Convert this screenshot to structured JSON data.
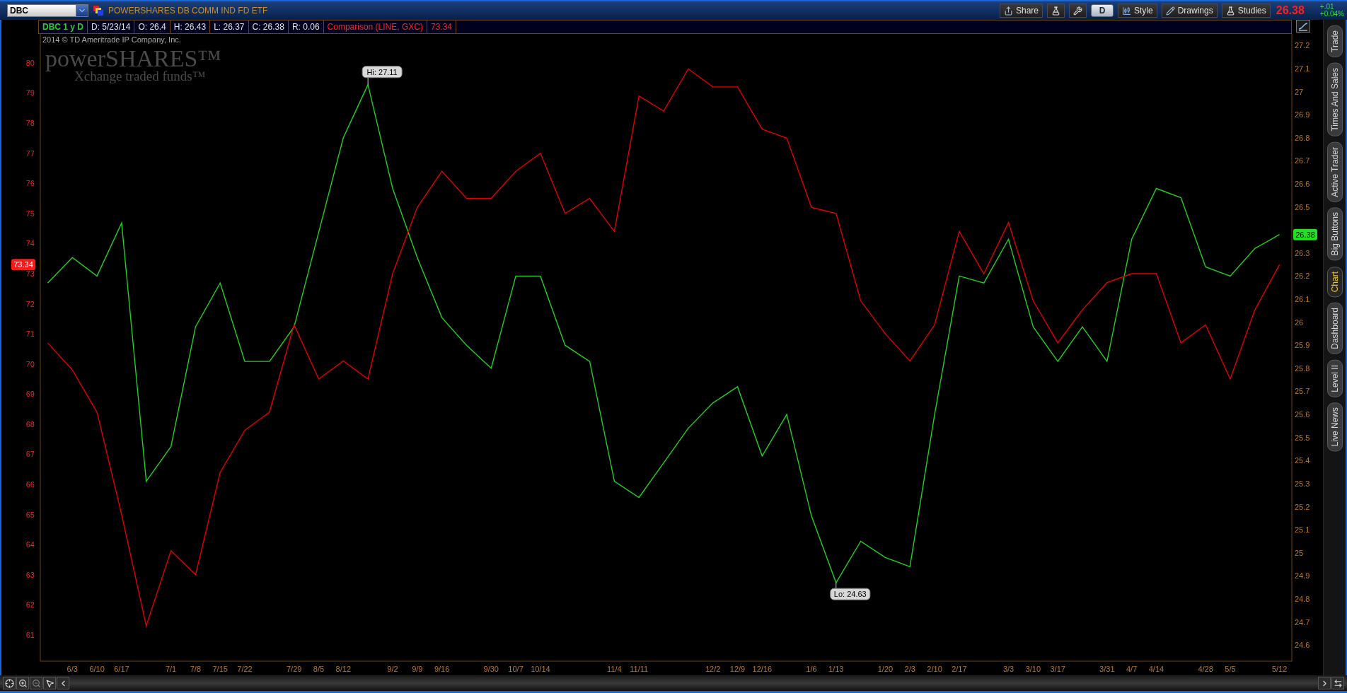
{
  "symbol_field": {
    "value": "DBC"
  },
  "security_title": "POWERSHARES DB COMM IND FD ETF",
  "toolbar": [
    {
      "kind": "share",
      "label": "Share"
    },
    {
      "kind": "studies_edit"
    },
    {
      "kind": "settings"
    },
    {
      "kind": "period",
      "label": "D"
    },
    {
      "kind": "style",
      "label": "Style"
    },
    {
      "kind": "drawings",
      "label": "Drawings"
    },
    {
      "kind": "studies",
      "label": "Studies"
    }
  ],
  "last_price": "26.38",
  "net_change": "+.01",
  "percent_change": "+0.04%",
  "info_bar": [
    {
      "kind": "symbol",
      "text": "DBC 1 y D"
    },
    {
      "kind": "stat",
      "text": "D: 5/23/14"
    },
    {
      "kind": "stat",
      "text": "O: 26.4"
    },
    {
      "kind": "stat",
      "text": "H: 26.43"
    },
    {
      "kind": "stat",
      "text": "L: 26.37"
    },
    {
      "kind": "stat",
      "text": "C: 26.38"
    },
    {
      "kind": "stat",
      "text": "R: 0.06"
    },
    {
      "kind": "comparison",
      "text": "Comparison (LINE, GXC)"
    },
    {
      "kind": "comparison",
      "text": "73.34"
    }
  ],
  "chart": {
    "copyright": "2014 © TD Ameritrade IP Company, Inc.",
    "logo": {
      "name": "powerSHARES™",
      "tagline": "Xchange traded funds™"
    },
    "left_badge": "73.34",
    "right_badge": "26.38",
    "chart_data": {
      "type": "line",
      "categories": [
        null,
        "6/3",
        "6/10",
        "6/17",
        null,
        "7/1",
        "7/8",
        "7/15",
        "7/22",
        null,
        "7/29",
        "8/5",
        "8/12",
        null,
        "9/2",
        "9/9",
        "9/16",
        null,
        "9/30",
        "10/7",
        "10/14",
        null,
        null,
        "11/4",
        "11/11",
        null,
        null,
        "12/2",
        "12/9",
        "12/16",
        null,
        "1/6",
        "1/13",
        null,
        "1/20",
        "2/3",
        "2/10",
        "2/17",
        null,
        "3/3",
        "3/10",
        "3/17",
        null,
        "3/31",
        "4/7",
        "4/14",
        null,
        "4/28",
        "5/5",
        null,
        "5/12"
      ],
      "series": [
        {
          "color": "#22d022",
          "values": [
            26.17,
            26.28,
            26.2,
            26.43,
            25.31,
            25.46,
            25.98,
            26.17,
            25.83,
            25.83,
            25.98,
            26.39,
            26.8,
            27.03,
            26.58,
            26.28,
            26.02,
            25.9,
            25.8,
            26.2,
            26.2,
            25.9,
            25.83,
            25.31,
            25.24,
            25.39,
            25.54,
            25.65,
            25.72,
            25.42,
            25.6,
            25.16,
            24.87,
            25.05,
            24.98,
            24.94,
            25.6,
            26.2,
            26.17,
            26.36,
            25.98,
            25.83,
            25.98,
            25.83,
            26.36,
            26.58,
            26.54,
            26.24,
            26.2,
            26.32,
            26.38
          ]
        },
        {
          "axis": "y2",
          "color": "#e00000",
          "values": [
            70.7,
            69.8,
            68.4,
            65.0,
            61.3,
            63.8,
            63.0,
            66.4,
            67.8,
            68.4,
            71.3,
            69.5,
            70.1,
            69.5,
            73.0,
            75.2,
            76.4,
            75.5,
            75.5,
            76.4,
            77.0,
            75.0,
            75.5,
            74.4,
            78.9,
            78.4,
            79.8,
            79.2,
            79.2,
            77.8,
            77.5,
            75.2,
            75.0,
            72.1,
            71.0,
            70.1,
            71.3,
            74.4,
            73.0,
            74.7,
            72.1,
            70.7,
            71.8,
            72.7,
            73.0,
            73.0,
            70.7,
            71.3,
            69.5,
            71.8,
            73.3
          ]
        }
      ],
      "ylim": [
        24.53,
        27.25
      ],
      "y2lim": [
        60.13,
        80.96
      ],
      "yticks": [
        24.6,
        24.7,
        24.8,
        24.9,
        25,
        25.1,
        25.2,
        25.3,
        25.4,
        25.5,
        25.6,
        25.7,
        25.8,
        25.9,
        26,
        26.1,
        26.2,
        26.3,
        26.5,
        26.6,
        26.7,
        26.8,
        26.9,
        27,
        27.1,
        27.2
      ],
      "y2ticks": [
        61,
        62,
        63,
        64,
        65,
        66,
        67,
        68,
        69,
        70,
        71,
        72,
        73,
        74,
        75,
        76,
        77,
        78,
        79,
        80
      ],
      "annotations": [
        "Hi: 27.11",
        "Lo: 24.63"
      ]
    }
  },
  "side_tabs": [
    {
      "label": "Trade",
      "selected": false
    },
    {
      "label": "Times And Sales",
      "selected": false
    },
    {
      "label": "Active Trader",
      "selected": false
    },
    {
      "label": "Big Buttons",
      "selected": false
    },
    {
      "label": "Chart",
      "selected": true
    },
    {
      "label": "Dashboard",
      "selected": false
    },
    {
      "label": "Level II",
      "selected": false
    },
    {
      "label": "Live News",
      "selected": false
    }
  ]
}
